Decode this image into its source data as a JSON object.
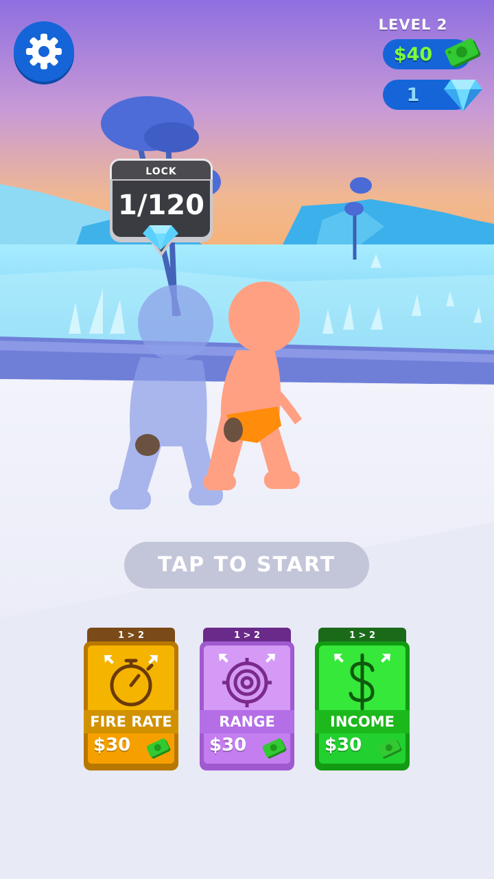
{
  "hud": {
    "level_label": "LEVEL 2",
    "cash": "$40",
    "gems": "1"
  },
  "lock": {
    "title": "LOCK",
    "progress": "1/120"
  },
  "start_button": {
    "label": "TAP TO START"
  },
  "upgrades": [
    {
      "tier": "1 > 2",
      "name": "FIRE RATE",
      "price": "$30",
      "icon": "stopwatch-icon",
      "color": "#f5b400"
    },
    {
      "tier": "1 > 2",
      "name": "RANGE",
      "price": "$30",
      "icon": "target-icon",
      "color": "#c77ef0"
    },
    {
      "tier": "1 > 2",
      "name": "INCOME",
      "price": "$30",
      "icon": "dollar-icon",
      "color": "#22d130"
    }
  ],
  "colors": {
    "accent_blue": "#1565d8",
    "cash_green": "#7dff3a",
    "gem_blue": "#8fd9ff"
  }
}
